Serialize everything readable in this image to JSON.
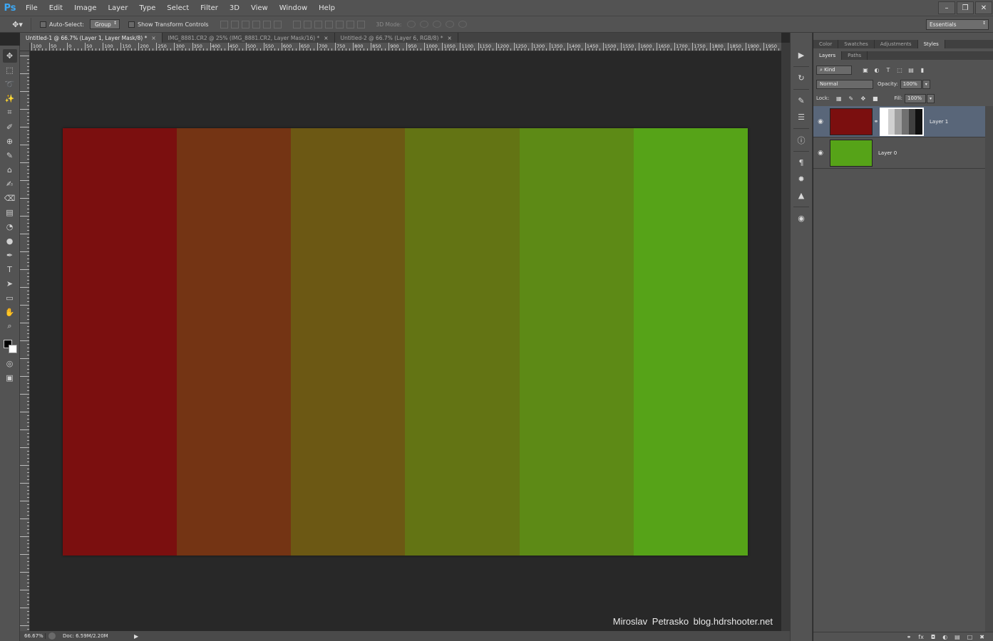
{
  "app": {
    "logo": "Ps"
  },
  "menu": [
    "File",
    "Edit",
    "Image",
    "Layer",
    "Type",
    "Select",
    "Filter",
    "3D",
    "View",
    "Window",
    "Help"
  ],
  "window_controls": {
    "minimize": "–",
    "restore": "❐",
    "close": "✕"
  },
  "options_bar": {
    "auto_select_label": "Auto-Select:",
    "auto_select_value": "Group",
    "transform_label": "Show Transform Controls",
    "mode3d_label": "3D Mode:",
    "workspace": "Essentials"
  },
  "tabs": [
    {
      "label": "Untitled-1 @ 66.7% (Layer 1, Layer Mask/8) *",
      "active": true
    },
    {
      "label": "IMG_8881.CR2 @ 25% (IMG_8881.CR2, Layer Mask/16) *",
      "active": false
    },
    {
      "label": "Untitled-2 @ 66.7% (Layer 6, RGB/8) *",
      "active": false
    }
  ],
  "ruler_h_labels": [
    "100",
    "50",
    "0",
    "50",
    "100",
    "150",
    "200",
    "250",
    "300",
    "350",
    "400",
    "450",
    "500",
    "550",
    "600",
    "650",
    "700",
    "750",
    "800",
    "850",
    "900",
    "950",
    "1000",
    "1050",
    "1100",
    "1150",
    "1200",
    "1250",
    "1300",
    "1350",
    "1400",
    "1450",
    "1500",
    "1550",
    "1600",
    "1650",
    "1700",
    "1750",
    "1800",
    "1850",
    "1900",
    "1950",
    "2"
  ],
  "document": {
    "strips": [
      "#7b0f0f",
      "#743414",
      "#6c5814",
      "#637414",
      "#5d8a16",
      "#56a318"
    ]
  },
  "watermark": "Miroslav  Petrasko  blog.hdrshooter.net",
  "status": {
    "zoom": "66.67%",
    "doc": "Doc: 6.59M/2.20M"
  },
  "panels": {
    "top_tabs": [
      "Color",
      "Swatches",
      "Adjustments",
      "Styles"
    ],
    "layer_tabs": [
      "Layers",
      "Paths"
    ],
    "filter_kind": "Kind",
    "blend_mode": "Normal",
    "opacity_label": "Opacity:",
    "opacity_value": "100%",
    "lock_label": "Lock:",
    "fill_label": "Fill:",
    "fill_value": "100%"
  },
  "layers": [
    {
      "name": "Layer 1",
      "selected": true,
      "thumb_color": "#7b0f0f",
      "mask": [
        "#ffffff",
        "#d0d0d0",
        "#a0a0a0",
        "#707070",
        "#404040",
        "#101010"
      ]
    },
    {
      "name": "Layer 0",
      "selected": false,
      "thumb_color": "#56a318"
    }
  ],
  "footer_icons": [
    "link-icon",
    "fx-icon",
    "mask-icon",
    "adjustment-icon",
    "folder-icon",
    "new-layer-icon",
    "trash-icon"
  ]
}
